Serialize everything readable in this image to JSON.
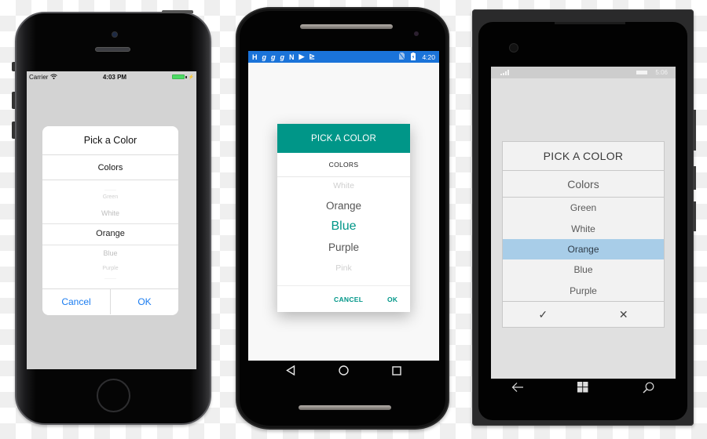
{
  "ios": {
    "status": {
      "carrier": "Carrier",
      "time": "4:03 PM",
      "wifi_icon": "wifi-icon",
      "battery_icon": "battery-icon"
    },
    "alert": {
      "title": "Pick a Color",
      "subtitle": "Colors",
      "picker": {
        "items": [
          "Green",
          "White",
          "Orange",
          "Blue",
          "Purple"
        ],
        "selected": "Orange"
      },
      "buttons": {
        "cancel": "Cancel",
        "ok": "OK"
      }
    },
    "accent": "#1a7cf0"
  },
  "android": {
    "status": {
      "time": "4:20",
      "notification_icons": [
        "H",
        "g",
        "g",
        "g",
        "N",
        "▶",
        "⊵"
      ],
      "icons": [
        "no-sim-icon",
        "battery-icon"
      ]
    },
    "dialog": {
      "title": "PICK A COLOR",
      "subtitle": "COLORS",
      "items": [
        "White",
        "Orange",
        "Blue",
        "Purple",
        "Pink"
      ],
      "selected": "Blue",
      "buttons": {
        "cancel": "CANCEL",
        "ok": "OK"
      }
    },
    "nav": {
      "back": "◁",
      "home": "○",
      "recents": "□"
    },
    "accent": "#009688",
    "status_bar_color": "#1a73d9"
  },
  "windows": {
    "status": {
      "time": "5:06",
      "icons": [
        "signal-icon",
        "battery-icon"
      ]
    },
    "dialog": {
      "title": "PICK A COLOR",
      "subtitle": "Colors",
      "items": [
        "Green",
        "White",
        "Orange",
        "Blue",
        "Purple"
      ],
      "selected": "Orange",
      "buttons": {
        "accept": "✓",
        "dismiss": "✕"
      }
    },
    "nav": {
      "back": "←",
      "search": "⌕"
    },
    "selection_color": "#a8cde8"
  }
}
